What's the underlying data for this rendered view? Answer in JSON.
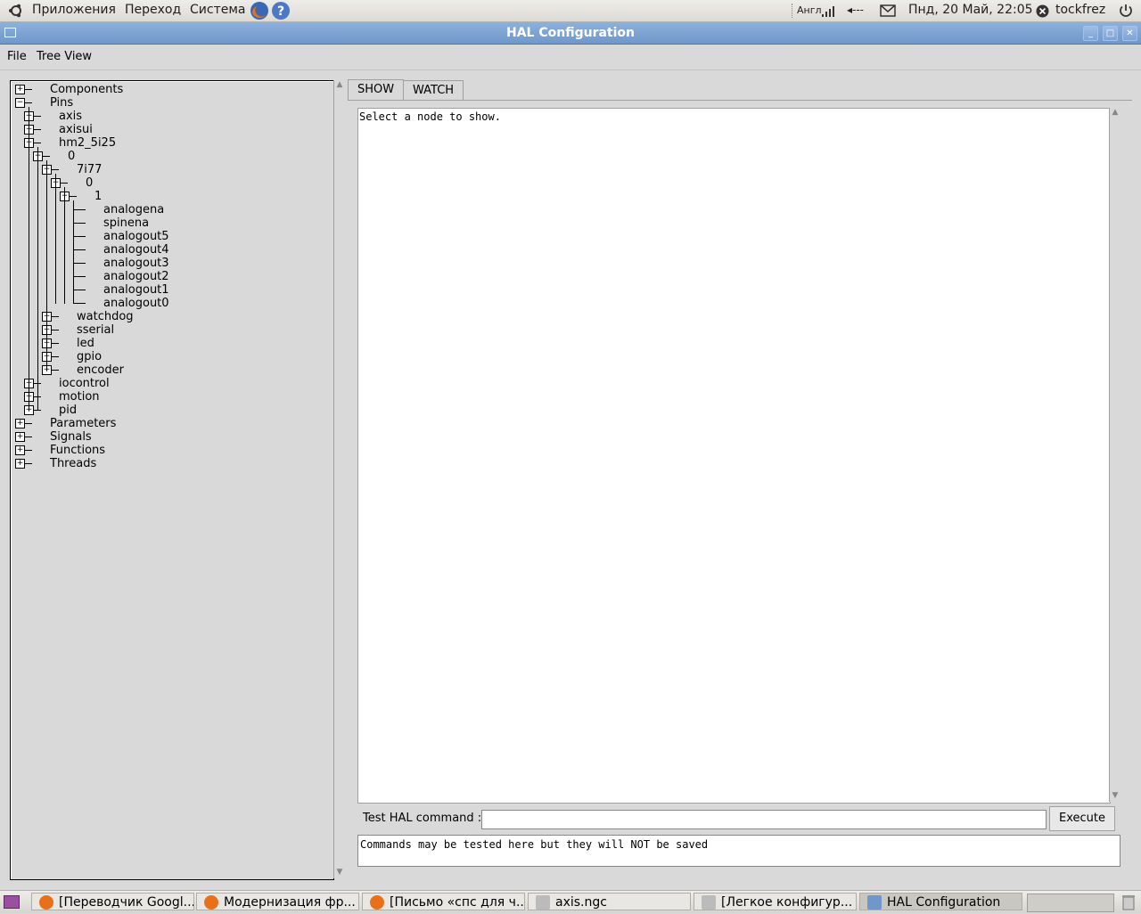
{
  "top_panel": {
    "apps_menu": "Приложения",
    "places_menu": "Переход",
    "system_menu": "Система",
    "keyboard_layout": "Англ",
    "sound_indicator": "◂---",
    "datetime": "Пнд, 20 Май, 22:05",
    "user": "tockfrez"
  },
  "window": {
    "title": "HAL Configuration"
  },
  "menu": {
    "file": "File",
    "tree_view": "Tree View"
  },
  "tree": {
    "items": [
      {
        "label": "Components"
      },
      {
        "label": "Pins"
      },
      {
        "label": "axis"
      },
      {
        "label": "axisui"
      },
      {
        "label": "hm2_5i25"
      },
      {
        "label": "0"
      },
      {
        "label": "7i77"
      },
      {
        "label": "0"
      },
      {
        "label": "1"
      },
      {
        "label": "analogena"
      },
      {
        "label": "spinena"
      },
      {
        "label": "analogout5"
      },
      {
        "label": "analogout4"
      },
      {
        "label": "analogout3"
      },
      {
        "label": "analogout2"
      },
      {
        "label": "analogout1"
      },
      {
        "label": "analogout0"
      },
      {
        "label": "watchdog"
      },
      {
        "label": "sserial"
      },
      {
        "label": "led"
      },
      {
        "label": "gpio"
      },
      {
        "label": "encoder"
      },
      {
        "label": "iocontrol"
      },
      {
        "label": "motion"
      },
      {
        "label": "pid"
      },
      {
        "label": "Parameters"
      },
      {
        "label": "Signals"
      },
      {
        "label": "Functions"
      },
      {
        "label": "Threads"
      }
    ]
  },
  "tabs": {
    "show": "SHOW",
    "watch": "WATCH"
  },
  "show_text": "Select a node to show.",
  "command": {
    "label": "Test HAL command :",
    "value": "",
    "execute": "Execute",
    "output": "Commands may be tested here but they will NOT be saved"
  },
  "taskbar": {
    "tasks": [
      {
        "label": "[Переводчик Googl..."
      },
      {
        "label": "Модернизация фр..."
      },
      {
        "label": "[Письмо «спс для ч..."
      },
      {
        "label": "axis.ngc"
      },
      {
        "label": "[Легкое конфигур..."
      },
      {
        "label": "HAL Configuration"
      }
    ]
  }
}
